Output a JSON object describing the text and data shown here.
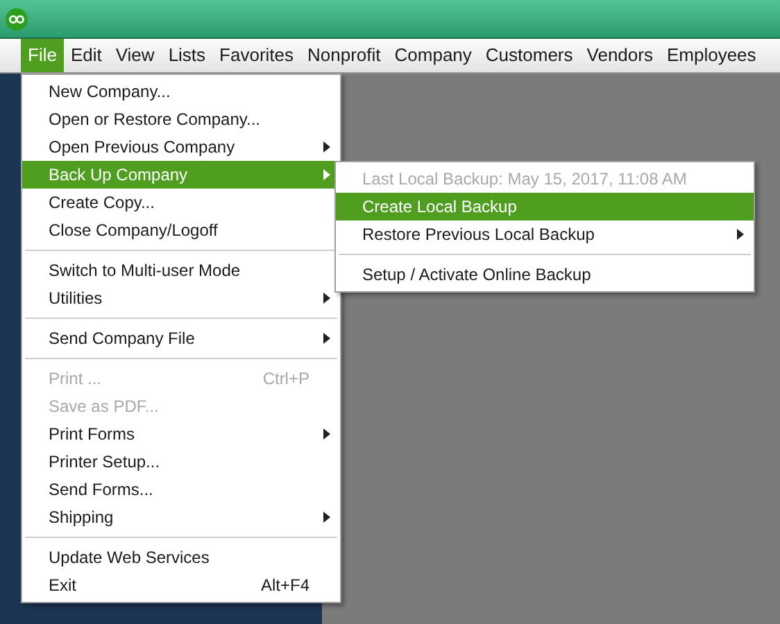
{
  "menubar": [
    {
      "label": "File",
      "selected": true
    },
    {
      "label": "Edit",
      "selected": false
    },
    {
      "label": "View",
      "selected": false
    },
    {
      "label": "Lists",
      "selected": false
    },
    {
      "label": "Favorites",
      "selected": false
    },
    {
      "label": "Nonprofit",
      "selected": false
    },
    {
      "label": "Company",
      "selected": false
    },
    {
      "label": "Customers",
      "selected": false
    },
    {
      "label": "Vendors",
      "selected": false
    },
    {
      "label": "Employees",
      "selected": false
    }
  ],
  "file_menu": [
    {
      "kind": "item",
      "label": "New Company...",
      "selected": false,
      "disabled": false,
      "submenu": false
    },
    {
      "kind": "item",
      "label": "Open or Restore Company...",
      "selected": false,
      "disabled": false,
      "submenu": false
    },
    {
      "kind": "item",
      "label": "Open Previous Company",
      "selected": false,
      "disabled": false,
      "submenu": true
    },
    {
      "kind": "item",
      "label": "Back Up Company",
      "selected": true,
      "disabled": false,
      "submenu": true
    },
    {
      "kind": "item",
      "label": "Create Copy...",
      "selected": false,
      "disabled": false,
      "submenu": false
    },
    {
      "kind": "item",
      "label": "Close Company/Logoff",
      "selected": false,
      "disabled": false,
      "submenu": false
    },
    {
      "kind": "separator"
    },
    {
      "kind": "item",
      "label": "Switch to Multi-user Mode",
      "selected": false,
      "disabled": false,
      "submenu": false
    },
    {
      "kind": "item",
      "label": "Utilities",
      "selected": false,
      "disabled": false,
      "submenu": true
    },
    {
      "kind": "separator"
    },
    {
      "kind": "item",
      "label": "Send Company File",
      "selected": false,
      "disabled": false,
      "submenu": true
    },
    {
      "kind": "separator"
    },
    {
      "kind": "item",
      "label": "Print ...",
      "shortcut": "Ctrl+P",
      "selected": false,
      "disabled": true,
      "submenu": false
    },
    {
      "kind": "item",
      "label": "Save as PDF...",
      "selected": false,
      "disabled": true,
      "submenu": false
    },
    {
      "kind": "item",
      "label": "Print Forms",
      "selected": false,
      "disabled": false,
      "submenu": true
    },
    {
      "kind": "item",
      "label": "Printer Setup...",
      "selected": false,
      "disabled": false,
      "submenu": false
    },
    {
      "kind": "item",
      "label": "Send Forms...",
      "selected": false,
      "disabled": false,
      "submenu": false
    },
    {
      "kind": "item",
      "label": "Shipping",
      "selected": false,
      "disabled": false,
      "submenu": true
    },
    {
      "kind": "separator"
    },
    {
      "kind": "item",
      "label": "Update Web Services",
      "selected": false,
      "disabled": false,
      "submenu": false
    },
    {
      "kind": "item",
      "label": "Exit",
      "shortcut": "Alt+F4",
      "selected": false,
      "disabled": false,
      "submenu": false
    }
  ],
  "backup_submenu": [
    {
      "kind": "item",
      "label": "Last Local Backup: May 15, 2017, 11:08 AM",
      "selected": false,
      "disabled": true,
      "submenu": false
    },
    {
      "kind": "item",
      "label": "Create Local Backup",
      "selected": true,
      "disabled": false,
      "submenu": false
    },
    {
      "kind": "item",
      "label": "Restore Previous Local Backup",
      "selected": false,
      "disabled": false,
      "submenu": true
    },
    {
      "kind": "separator"
    },
    {
      "kind": "item",
      "label": "Setup / Activate Online Backup",
      "selected": false,
      "disabled": false,
      "submenu": false
    }
  ]
}
